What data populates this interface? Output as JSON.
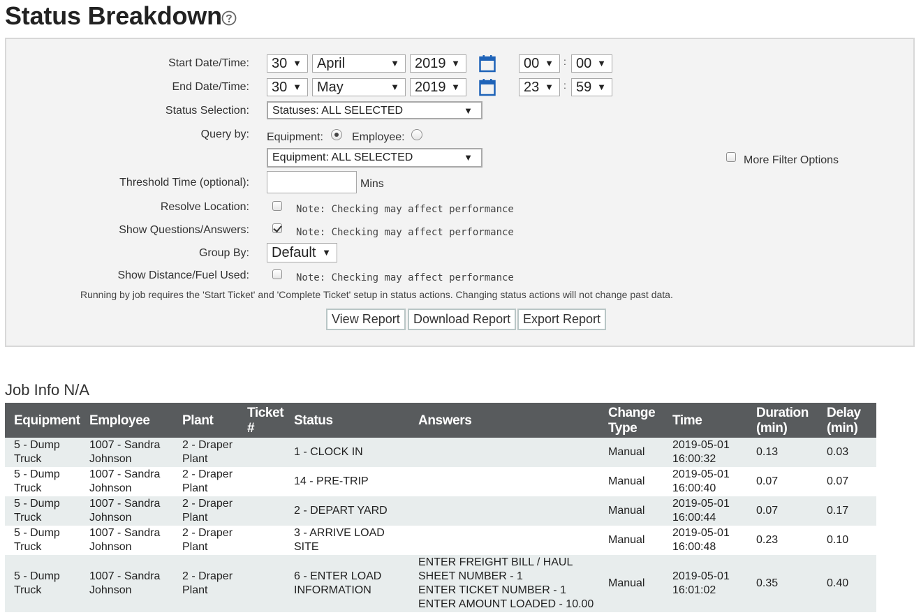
{
  "page": {
    "title": "Status Breakdown",
    "help_icon": "question-circle-icon"
  },
  "filters": {
    "start": {
      "label": "Start Date/Time:",
      "day": "30",
      "month": "April",
      "year": "2019",
      "hour": "00",
      "minute": "00"
    },
    "end": {
      "label": "End Date/Time:",
      "day": "30",
      "month": "May",
      "year": "2019",
      "hour": "23",
      "minute": "59"
    },
    "time_separator": ":",
    "status_selection": {
      "label": "Status Selection:",
      "value": "Statuses: ALL SELECTED"
    },
    "query_by": {
      "label": "Query by:",
      "option_equipment": "Equipment:",
      "option_employee": "Employee:",
      "selected": "Equipment",
      "value": "Equipment: ALL SELECTED"
    },
    "more_filter_options": "More Filter Options",
    "threshold": {
      "label": "Threshold Time (optional):",
      "value": "",
      "unit": "Mins"
    },
    "resolve_location": {
      "label": "Resolve Location:",
      "checked": false,
      "note": "Note: Checking may affect performance"
    },
    "show_questions": {
      "label": "Show Questions/Answers:",
      "checked": true,
      "note": "Note: Checking may affect performance"
    },
    "group_by": {
      "label": "Group By:",
      "value": "Default"
    },
    "show_distance": {
      "label": "Show Distance/Fuel Used:",
      "checked": false,
      "note": "Note: Checking may affect performance"
    },
    "info_text": "Running by job requires the 'Start Ticket' and 'Complete Ticket' setup in status actions. Changing status actions will not change past data.",
    "buttons": {
      "view": "View Report",
      "download": "Download Report",
      "export": "Export Report"
    }
  },
  "report": {
    "section_title": "Job Info N/A",
    "headers": [
      "Equipment",
      "Employee",
      "Plant",
      "Ticket #",
      "Status",
      "Answers",
      "Change Type",
      "Time",
      "Duration (min)",
      "Delay (min)"
    ],
    "rows": [
      {
        "equipment": "5 - Dump Truck",
        "employee": "1007 - Sandra Johnson",
        "plant": "2 - Draper Plant",
        "ticket": "",
        "status": "1 - CLOCK IN",
        "answers": [],
        "change_type": "Manual",
        "time": "2019-05-01 16:00:32",
        "duration": "0.13",
        "delay": "0.03"
      },
      {
        "equipment": "5 - Dump Truck",
        "employee": "1007 - Sandra Johnson",
        "plant": "2 - Draper Plant",
        "ticket": "",
        "status": "14 - PRE-TRIP",
        "answers": [],
        "change_type": "Manual",
        "time": "2019-05-01 16:00:40",
        "duration": "0.07",
        "delay": "0.07"
      },
      {
        "equipment": "5 - Dump Truck",
        "employee": "1007 - Sandra Johnson",
        "plant": "2 - Draper Plant",
        "ticket": "",
        "status": "2 - DEPART YARD",
        "answers": [],
        "change_type": "Manual",
        "time": "2019-05-01 16:00:44",
        "duration": "0.07",
        "delay": "0.17"
      },
      {
        "equipment": "5 - Dump Truck",
        "employee": "1007 - Sandra Johnson",
        "plant": "2 - Draper Plant",
        "ticket": "",
        "status": "3 - ARRIVE LOAD SITE",
        "answers": [],
        "change_type": "Manual",
        "time": "2019-05-01 16:00:48",
        "duration": "0.23",
        "delay": "0.10"
      },
      {
        "equipment": "5 - Dump Truck",
        "employee": "1007 - Sandra Johnson",
        "plant": "2 - Draper Plant",
        "ticket": "",
        "status": "6 - ENTER LOAD INFORMATION",
        "answers": [
          "ENTER FREIGHT BILL / HAUL SHEET NUMBER - 1",
          "ENTER TICKET NUMBER - 1",
          "ENTER AMOUNT LOADED - 10.00"
        ],
        "change_type": "Manual",
        "time": "2019-05-01 16:01:02",
        "duration": "0.35",
        "delay": "0.40"
      }
    ]
  },
  "colors": {
    "header_bg": "#585b5d",
    "row_alt_bg": "#e8eded",
    "panel_bg": "#f3f3f3",
    "calendar_blue": "#1e63b8"
  }
}
